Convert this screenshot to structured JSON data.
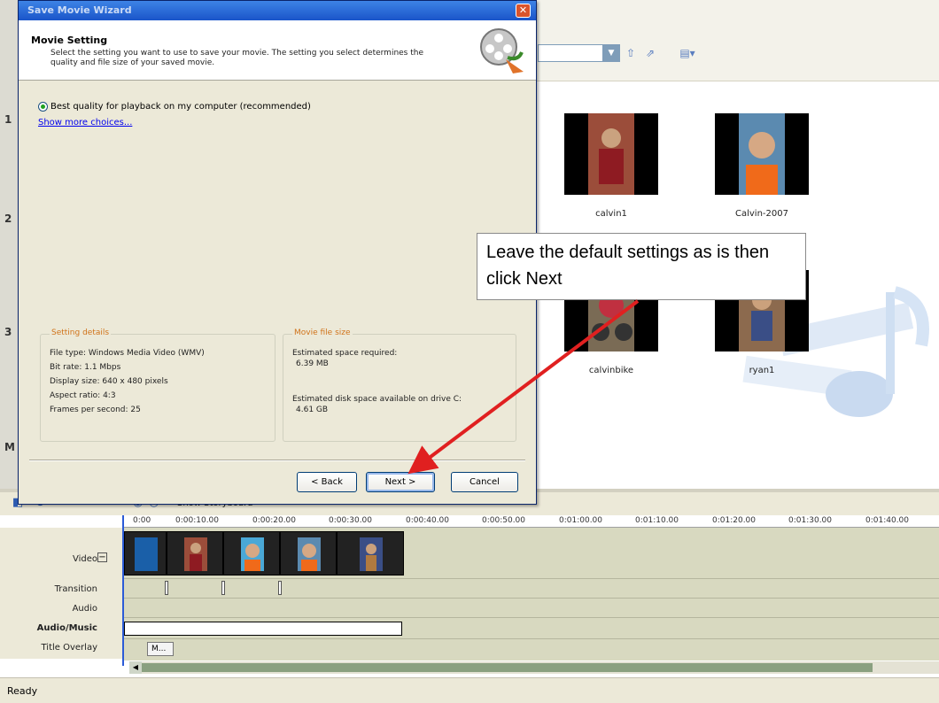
{
  "colors": {
    "accent": "#e02020",
    "title_blue": "#1a55c9",
    "orange_label": "#d0731a"
  },
  "left_numbers": [
    "1",
    "2",
    "3",
    "M"
  ],
  "collection": {
    "items": [
      {
        "label": "calvin1"
      },
      {
        "label": "Calvin-2007"
      },
      {
        "label": "calvinbike"
      },
      {
        "label": "ryan1"
      }
    ]
  },
  "timeline": {
    "storyboard_label": "Show Storyboard",
    "ruler": [
      "0:00",
      "0:00:10.00",
      "0:00:20.00",
      "0:00:30.00",
      "0:00:40.00",
      "0:00:50.00",
      "0:01:00.00",
      "0:01:10.00",
      "0:01:20.00",
      "0:01:30.00",
      "0:01:40.00"
    ],
    "tracks": [
      "Video",
      "Transition",
      "Audio",
      "Audio/Music",
      "Title Overlay"
    ],
    "overlay_clip": "M..."
  },
  "status": {
    "text": "Ready"
  },
  "wizard": {
    "title": "Save Movie Wizard",
    "close_glyph": "✕",
    "header_title": "Movie Setting",
    "header_desc": "Select the setting you want to use to save your movie. The setting you select determines the quality and file size of your saved movie.",
    "option": "Best quality for playback on my computer (recommended)",
    "more_choices": "Show more choices...",
    "details": {
      "legend": "Setting details",
      "lines": [
        "File type: Windows Media Video (WMV)",
        "Bit rate: 1.1 Mbps",
        "Display size: 640 x 480 pixels",
        "Aspect ratio: 4:3",
        "Frames per second: 25"
      ]
    },
    "filesize": {
      "legend": "Movie file size",
      "required_label": "Estimated space required:",
      "required_value": "6.39 MB",
      "available_label": "Estimated disk space available on drive C:",
      "available_value": "4.61 GB"
    },
    "buttons": {
      "back": "< Back",
      "next": "Next >",
      "cancel": "Cancel"
    }
  },
  "callout": {
    "text": "Leave the default settings as is then click Next"
  }
}
